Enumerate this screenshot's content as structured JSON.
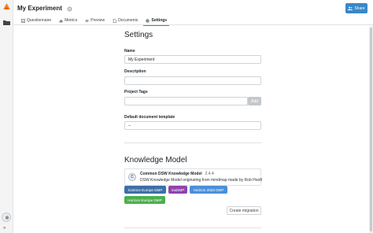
{
  "app": {
    "title": "My Experiment",
    "share_label": "Share",
    "accent": "#3a87c8"
  },
  "tabs": [
    {
      "label": "Questionnaire",
      "icon": "questionnaire-icon",
      "active": false
    },
    {
      "label": "Metrics",
      "icon": "metrics-icon",
      "active": false
    },
    {
      "label": "Preview",
      "icon": "eye-icon",
      "active": false
    },
    {
      "label": "Documents",
      "icon": "documents-icon",
      "active": false
    },
    {
      "label": "Settings",
      "icon": "settings-icon",
      "active": true
    }
  ],
  "settings": {
    "heading": "Settings",
    "name_label": "Name",
    "name_value": "My Experiment",
    "description_label": "Description",
    "description_value": "",
    "tags_label": "Project Tags",
    "tags_value": "",
    "add_label": "Add",
    "template_label": "Default document template",
    "template_value": "--"
  },
  "knowledge_model": {
    "heading": "Knowledge Model",
    "icon_letter": "C",
    "name": "Common DSW Knowledge Model",
    "version": "2.4.4",
    "description": "DSW Knowledge Model originating from mindmap made by Rob Hooft",
    "tags": [
      {
        "label": "Science Europe DMP",
        "color": "#3d6fa8"
      },
      {
        "label": "maDMP",
        "color": "#8e44ad"
      },
      {
        "label": "Horizon 2020 DMP",
        "color": "#4a90d9"
      },
      {
        "label": "Horizon Europe DMP",
        "color": "#4caf50"
      }
    ],
    "create_migration_label": "Create migration"
  }
}
